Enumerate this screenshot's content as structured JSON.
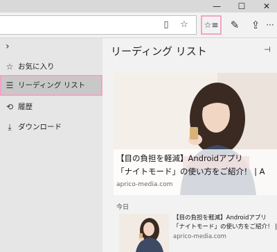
{
  "window": {
    "minimize_glyph": "—",
    "maximize_glyph": "☐",
    "close_glyph": "✕"
  },
  "toolbar": {
    "icons": [
      "reading-view-icon",
      "favorite-star-icon",
      "hub-icon",
      "web-note-icon",
      "share-icon",
      "more-icon"
    ],
    "reading_view_glyph": "▯",
    "favorite_glyph": "☆",
    "hub_glyph": "☆≡",
    "note_glyph": "✎",
    "share_glyph": "⇪",
    "more_glyph": "···"
  },
  "hub": {
    "toggle_glyph": "›",
    "items": [
      {
        "label": "お気に入り",
        "icon": "star-icon",
        "glyph": "☆"
      },
      {
        "label": "リーディング リスト",
        "icon": "reading-list-icon",
        "glyph": "☰",
        "selected": true
      },
      {
        "label": "履歴",
        "icon": "history-icon",
        "glyph": "⟲"
      },
      {
        "label": "ダウンロード",
        "icon": "download-icon",
        "glyph": "⤓"
      }
    ]
  },
  "reading_list": {
    "title": "リーディング リスト",
    "pin_glyph": "⊣",
    "featured": {
      "title_line1": "【目の負担を軽減】Androidアプリ",
      "title_line2": "「ナイトモード」の使い方をご紹介！ | A",
      "domain": "aprico-media.com"
    },
    "section_label": "今日",
    "items": [
      {
        "title_line1": "【目の負担を軽減】Androidアプリ",
        "title_line2": "「ナイトモード」の使い方をご紹介！ |",
        "domain": "aprico-media.com"
      }
    ]
  },
  "colors": {
    "highlight_border": "#f3a3c7",
    "sidebar_bg": "#e6e6e6",
    "selected_bg": "#c8c8c8"
  }
}
